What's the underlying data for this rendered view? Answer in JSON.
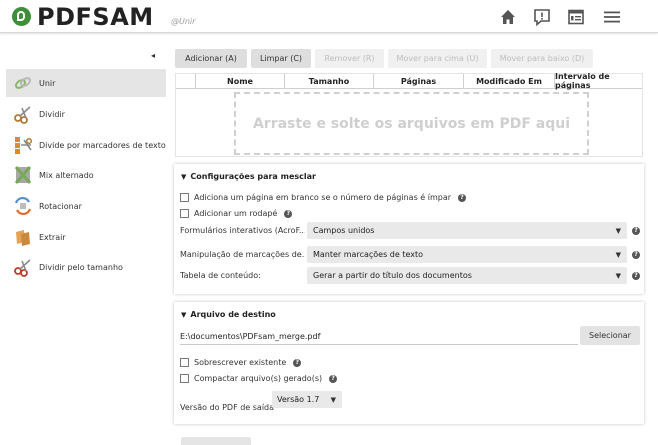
{
  "header": {
    "logo_text": "PDFSAM",
    "logo_sub": "@Unir",
    "icons": [
      "home-icon",
      "news-icon",
      "dashboard-icon",
      "menu-icon"
    ]
  },
  "sidebar": {
    "collapse_glyph": "◂",
    "items": [
      {
        "label": "Unir",
        "icon": "merge-icon",
        "active": true
      },
      {
        "label": "Dividir",
        "icon": "scissors-icon"
      },
      {
        "label": "Divide por marcadores de texto",
        "icon": "split-bookmarks-icon"
      },
      {
        "label": "Mix alternado",
        "icon": "mix-icon"
      },
      {
        "label": "Rotacionar",
        "icon": "rotate-icon"
      },
      {
        "label": "Extrair",
        "icon": "extract-icon"
      },
      {
        "label": "Dividir pelo tamanho",
        "icon": "split-size-icon"
      }
    ]
  },
  "toolbar": {
    "add": "Adicionar (A)",
    "clear": "Limpar (C)",
    "remove": "Remover (R)",
    "move_up": "Mover para cima (U)",
    "move_down": "Mover para baixo (D)"
  },
  "table": {
    "columns": [
      "Nome",
      "Tamanho",
      "Páginas",
      "Modificado Em",
      "Intervalo de páginas"
    ],
    "drop_hint": "Arraste e solte os arquivos em PDF aqui"
  },
  "merge_settings": {
    "title": "Configurações para mesclar",
    "blank_page_label": "Adiciona um página em branco se o número de páginas é ímpar",
    "footer_label": "Adicionar um rodapé",
    "forms_label": "Formulários interativos (AcroF...",
    "forms_value": "Campos unidos",
    "bookmarks_label": "Manipulação de marcações de...",
    "bookmarks_value": "Manter marcações de texto",
    "toc_label": "Tabela de conteúdo:",
    "toc_value": "Gerar a partir do título dos documentos"
  },
  "destination": {
    "title": "Arquivo de destino",
    "path": "E:\\documentos\\PDFsam_merge.pdf",
    "select_button": "Selecionar",
    "overwrite_label": "Sobrescrever existente",
    "compress_label": "Compactar arquivo(s) gerado(s)",
    "version_label": "Versão do PDF de saída",
    "version_value": "Versão 1.7"
  }
}
